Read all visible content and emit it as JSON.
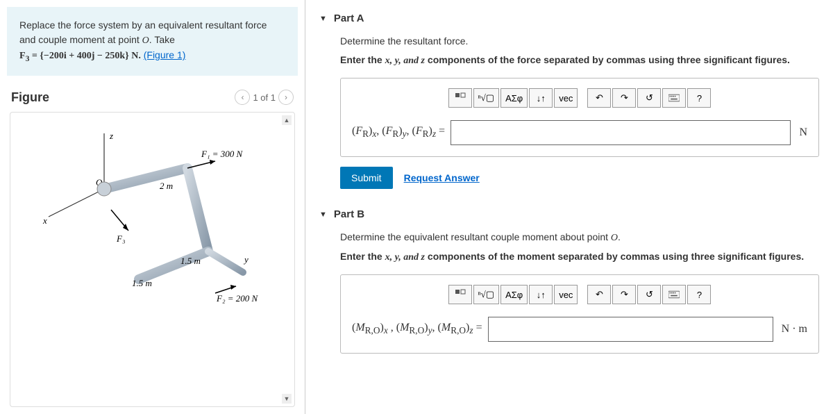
{
  "problem": {
    "line1_pre": "Replace the force system by an equivalent resultant force and couple moment at point ",
    "point": "O",
    "line1_post": ". Take",
    "f3_eq": "F₃ = {−200i + 400j − 250k} N.",
    "figure_link": "(Figure 1)"
  },
  "figure": {
    "title": "Figure",
    "pager": "1 of 1",
    "labels": {
      "z": "z",
      "x": "x",
      "y": "y",
      "O": "O",
      "F1": "F₁ = 300 N",
      "F2": "F₂ = 200 N",
      "F3": "F₃",
      "d2m": "2 m",
      "d15a": "1.5 m",
      "d15b": "1.5 m"
    }
  },
  "partA": {
    "title": "Part A",
    "instr1": "Determine the resultant force.",
    "instr2_pre": "Enter the ",
    "instr2_post": " components of the force separated by commas using three significant figures.",
    "vars": "x, y, and z",
    "input_label_html": "(F_R)_x, (F_R)_y, (F_R)_z =",
    "unit": "N",
    "submit": "Submit",
    "request": "Request Answer"
  },
  "partB": {
    "title": "Part B",
    "instr1_pre": "Determine the equivalent resultant couple moment about point ",
    "instr1_point": "O",
    "instr1_post": ".",
    "instr2_pre": "Enter the ",
    "instr2_post": " components of the moment separated by commas using three significant figures.",
    "vars": "x, y, and z",
    "input_label_html": "(M_{R,O})_x , (M_{R,O})_y , (M_{R,O})_z =",
    "unit": "N · m"
  },
  "toolbar": {
    "template": "template-icon",
    "sqrt": "√",
    "greek": "ΑΣφ",
    "updown": "↓↑",
    "vec": "vec",
    "undo": "↶",
    "redo": "↷",
    "reset": "↺",
    "keyboard": "⌨",
    "help": "?"
  }
}
